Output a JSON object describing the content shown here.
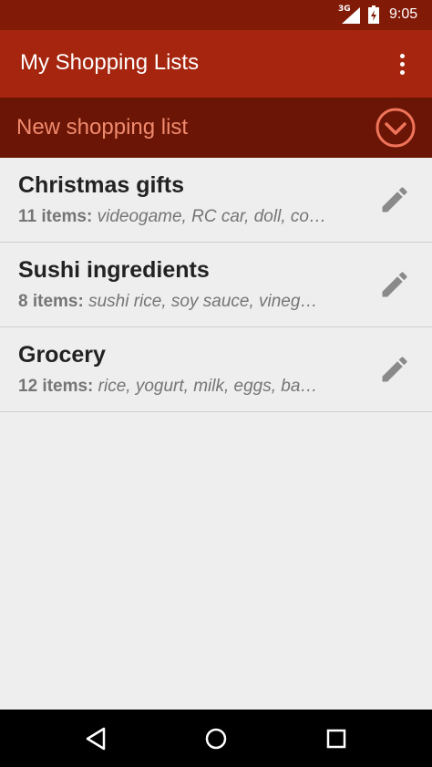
{
  "status_bar": {
    "network": "3G",
    "time": "9:05"
  },
  "app_bar": {
    "title": "My Shopping Lists",
    "overflow_icon": "more-vert-icon"
  },
  "new_list": {
    "placeholder": "New shopping list",
    "confirm_icon": "check-circle-icon",
    "accent_color": "#f0745a"
  },
  "lists": [
    {
      "name": "Christmas gifts",
      "count": "11 items:",
      "preview": "videogame, RC car, doll, co…"
    },
    {
      "name": "Sushi ingredients",
      "count": "8 items:",
      "preview": "sushi rice, soy sauce, vineg…"
    },
    {
      "name": "Grocery",
      "count": "12 items:",
      "preview": "rice, yogurt, milk, eggs, ba…"
    }
  ],
  "nav_bar": {
    "back_icon": "back-triangle-icon",
    "home_icon": "home-circle-icon",
    "recents_icon": "recents-square-icon"
  },
  "colors": {
    "status_bar": "#821a08",
    "app_bar": "#a6250e",
    "new_bar": "#6b1506",
    "background": "#eeeeee"
  }
}
